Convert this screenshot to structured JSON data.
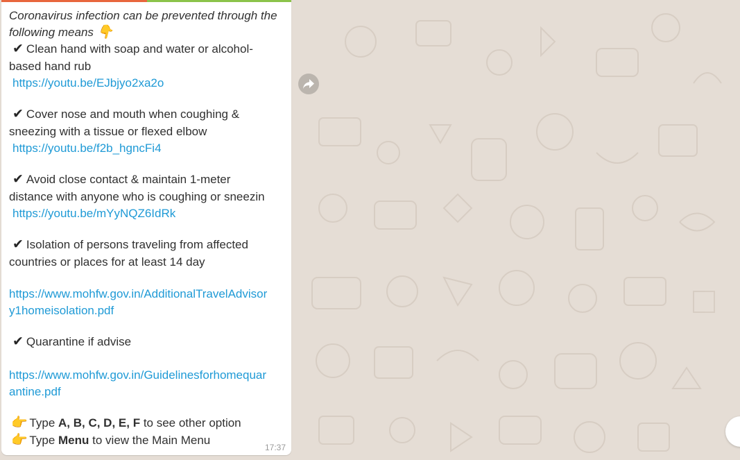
{
  "message": {
    "intro_line1": "Coronavirus infection can be prevented through the",
    "intro_line2": "following means",
    "intro_emoji": "👇",
    "item1_line1": "Clean hand with soap and water or alcohol-",
    "item1_line2": "based hand rub",
    "item1_link": "https://youtu.be/EJbjyo2xa2o",
    "item2_line1": "Cover nose and mouth when coughing &",
    "item2_line2": "sneezing with a tissue or flexed elbow",
    "item2_link": "https://youtu.be/f2b_hgncFi4",
    "item3_line1": "Avoid close contact & maintain 1-meter",
    "item3_line2": "distance with anyone who is coughing or sneezin",
    "item3_link": "https://youtu.be/mYyNQZ6IdRk",
    "item4_line1": "Isolation of persons traveling from affected",
    "item4_line2": "countries or places for at least 14 day",
    "item4_link_line1": "https://www.mohfw.gov.in/AdditionalTravelAdvisor",
    "item4_link_line2": "y1homeisolation.pdf",
    "item5_line1": "Quarantine if advise",
    "item5_link_line1": "https://www.mohfw.gov.in/Guidelinesforhomequar",
    "item5_link_line2": "antine.pdf",
    "check_glyph": "✔",
    "hand_glyph": "👉",
    "type1_prefix": "Type",
    "type1_bold": "A, B, C, D, E, F",
    "type1_suffix": "to see other option",
    "type2_prefix": "Type",
    "type2_bold": "Menu",
    "type2_suffix": "to view the Main Menu",
    "time": "17:37"
  },
  "colors": {
    "link": "#1f9ad6",
    "chat_background": "#e5ddd5",
    "bubble": "#ffffff"
  },
  "icons": {
    "forward": "forward-icon",
    "scroll_down": "chevron-down-icon"
  }
}
